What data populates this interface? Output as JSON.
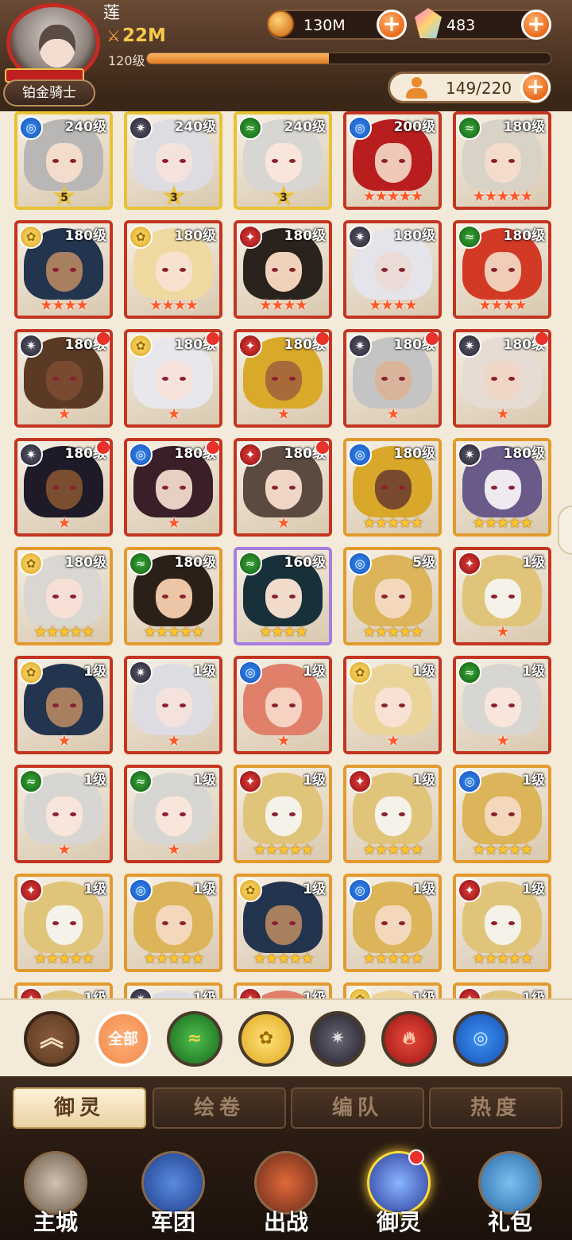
{
  "player": {
    "name": "莲",
    "power": "22M",
    "level": "120级",
    "exp_fraction": 0.45,
    "rank_title": "铂金骑士"
  },
  "resources": {
    "gold": "130M",
    "gems": "483",
    "capacity": "149/220"
  },
  "elements_legend": {
    "water": "#1f6fd6",
    "dark": "#3a3845",
    "wind": "#1f8a2a",
    "fire": "#c9221f",
    "light": "#e8b52a"
  },
  "heroes": [
    {
      "level": "240级",
      "element": "water",
      "stars": 0,
      "badge": "5",
      "frame": "yellow",
      "hair": "#b9b7b5",
      "skin": "#f3dccc"
    },
    {
      "level": "240级",
      "element": "dark",
      "stars": 0,
      "badge": "3",
      "frame": "yellow",
      "hair": "#dcdce2",
      "skin": "#f5e2dc"
    },
    {
      "level": "240级",
      "element": "wind",
      "stars": 0,
      "badge": "3",
      "frame": "yellow",
      "hair": "#d8d6d2",
      "skin": "#f8e6da"
    },
    {
      "level": "200级",
      "element": "water",
      "stars": 5,
      "badge": "",
      "frame": "red",
      "hair": "#b81e1e",
      "skin": "#f0c8b8"
    },
    {
      "level": "180级",
      "element": "wind",
      "stars": 5,
      "badge": "",
      "frame": "red",
      "hair": "#d9d2c6",
      "skin": "#f4dccc"
    },
    {
      "level": "180级",
      "element": "light",
      "stars": 4,
      "badge": "",
      "frame": "red",
      "hair": "#23344f",
      "skin": "#a88060"
    },
    {
      "level": "180级",
      "element": "light",
      "stars": 4,
      "badge": "",
      "frame": "red",
      "hair": "#eed9a0",
      "skin": "#f7e2d0"
    },
    {
      "level": "180级",
      "element": "fire",
      "stars": 4,
      "badge": "",
      "frame": "red",
      "hair": "#2a221c",
      "skin": "#f0d2bb"
    },
    {
      "level": "180级",
      "element": "dark",
      "stars": 4,
      "badge": "",
      "frame": "red",
      "hair": "#e4e4ea",
      "skin": "#ebdcd8"
    },
    {
      "level": "180级",
      "element": "wind",
      "stars": 4,
      "badge": "",
      "frame": "red",
      "hair": "#d23a26",
      "skin": "#f1ccb6"
    },
    {
      "level": "180级",
      "element": "dark",
      "stars": 1,
      "badge": "",
      "frame": "red",
      "hair": "#5a3a24",
      "skin": "#7a4a30",
      "notify": true
    },
    {
      "level": "180级",
      "element": "light",
      "stars": 1,
      "badge": "",
      "frame": "red",
      "hair": "#e8e8ec",
      "skin": "#f6e4dc",
      "notify": true
    },
    {
      "level": "180级",
      "element": "fire",
      "stars": 1,
      "badge": "",
      "frame": "red",
      "hair": "#d9aa2a",
      "skin": "#a86a38",
      "notify": true
    },
    {
      "level": "180级",
      "element": "dark",
      "stars": 1,
      "badge": "",
      "frame": "red",
      "hair": "#c4c4c4",
      "skin": "#d9b49a",
      "notify": true
    },
    {
      "level": "180级",
      "element": "dark",
      "stars": 1,
      "badge": "",
      "frame": "red",
      "hair": "#e6dcd4",
      "skin": "#efd6c6",
      "notify": true
    },
    {
      "level": "180级",
      "element": "dark",
      "stars": 1,
      "badge": "",
      "frame": "red",
      "hair": "#1e1a28",
      "skin": "#7a4e2e",
      "notify": true
    },
    {
      "level": "180级",
      "element": "water",
      "stars": 1,
      "badge": "",
      "frame": "red",
      "hair": "#3a1e28",
      "skin": "#e8cfc4",
      "notify": true
    },
    {
      "level": "180级",
      "element": "fire",
      "stars": 1,
      "badge": "",
      "frame": "red",
      "hair": "#5a4a40",
      "skin": "#f0d6c6",
      "notify": true
    },
    {
      "level": "180级",
      "element": "water",
      "stars": 5,
      "badge": "",
      "frame": "orange",
      "hair": "#d9a82a",
      "skin": "#7a4a2e"
    },
    {
      "level": "180级",
      "element": "dark",
      "stars": 5,
      "badge": "",
      "frame": "orange",
      "hair": "#6a5a8a",
      "skin": "#eeeaf0"
    },
    {
      "level": "180级",
      "element": "light",
      "stars": 5,
      "badge": "",
      "frame": "orange",
      "hair": "#dad6d2",
      "skin": "#f6e0d6"
    },
    {
      "level": "180级",
      "element": "wind",
      "stars": 5,
      "badge": "",
      "frame": "orange",
      "hair": "#2a2018",
      "skin": "#ecc6a6"
    },
    {
      "level": "160级",
      "element": "wind",
      "stars": 4,
      "badge": "",
      "frame": "purple",
      "hair": "#18303a",
      "skin": "#f1dccc"
    },
    {
      "level": "5级",
      "element": "water",
      "stars": 5,
      "badge": "",
      "frame": "orange",
      "hair": "#dcb45a",
      "skin": "#f4d8bc"
    },
    {
      "level": "1级",
      "element": "fire",
      "stars": 1,
      "badge": "",
      "frame": "red",
      "hair": "#e0c47a",
      "skin": "#f5f2ea"
    },
    {
      "level": "1级",
      "element": "light",
      "stars": 1,
      "badge": "",
      "frame": "red",
      "hair": "#23344f",
      "skin": "#a88060"
    },
    {
      "level": "1级",
      "element": "dark",
      "stars": 1,
      "badge": "",
      "frame": "red",
      "hair": "#dcdce2",
      "skin": "#f5e2dc"
    },
    {
      "level": "1级",
      "element": "water",
      "stars": 1,
      "badge": "",
      "frame": "red",
      "hair": "#e0806a",
      "skin": "#f5d2c2"
    },
    {
      "level": "1级",
      "element": "light",
      "stars": 1,
      "badge": "",
      "frame": "red",
      "hair": "#ead49a",
      "skin": "#f7e2d4"
    },
    {
      "level": "1级",
      "element": "wind",
      "stars": 1,
      "badge": "",
      "frame": "red",
      "hair": "#d8d6d2",
      "skin": "#f8e6da"
    },
    {
      "level": "1级",
      "element": "wind",
      "stars": 1,
      "badge": "",
      "frame": "red",
      "hair": "#d8d6d2",
      "skin": "#f8e6da"
    },
    {
      "level": "1级",
      "element": "wind",
      "stars": 1,
      "badge": "",
      "frame": "red",
      "hair": "#d8d6d2",
      "skin": "#f8e6da"
    },
    {
      "level": "1级",
      "element": "fire",
      "stars": 5,
      "badge": "",
      "frame": "orange",
      "hair": "#e0c47a",
      "skin": "#f5f2ea"
    },
    {
      "level": "1级",
      "element": "fire",
      "stars": 5,
      "badge": "",
      "frame": "orange",
      "hair": "#e0c47a",
      "skin": "#f5f2ea"
    },
    {
      "level": "1级",
      "element": "water",
      "stars": 5,
      "badge": "",
      "frame": "orange",
      "hair": "#dcb45a",
      "skin": "#f4d8bc"
    },
    {
      "level": "1级",
      "element": "fire",
      "stars": 5,
      "badge": "",
      "frame": "orange",
      "hair": "#e0c47a",
      "skin": "#f5f2ea"
    },
    {
      "level": "1级",
      "element": "water",
      "stars": 5,
      "badge": "",
      "frame": "orange",
      "hair": "#dcb45a",
      "skin": "#f4d8bc"
    },
    {
      "level": "1级",
      "element": "light",
      "stars": 5,
      "badge": "",
      "frame": "orange",
      "hair": "#23344f",
      "skin": "#a88060"
    },
    {
      "level": "1级",
      "element": "water",
      "stars": 5,
      "badge": "",
      "frame": "orange",
      "hair": "#dcb45a",
      "skin": "#f4d8bc"
    },
    {
      "level": "1级",
      "element": "fire",
      "stars": 5,
      "badge": "",
      "frame": "orange",
      "hair": "#e0c47a",
      "skin": "#f5f2ea"
    },
    {
      "level": "1级",
      "element": "fire",
      "stars": 0,
      "badge": "",
      "frame": "orange",
      "hair": "#e0c47a",
      "skin": "#f5f2ea"
    },
    {
      "level": "1级",
      "element": "dark",
      "stars": 0,
      "badge": "",
      "frame": "orange",
      "hair": "#dcdce2",
      "skin": "#f5e2dc"
    },
    {
      "level": "1级",
      "element": "fire",
      "stars": 0,
      "badge": "",
      "frame": "orange",
      "hair": "#e0806a",
      "skin": "#f5d2c2"
    },
    {
      "level": "1级",
      "element": "light",
      "stars": 0,
      "badge": "",
      "frame": "orange",
      "hair": "#ead49a",
      "skin": "#f7e2d4"
    },
    {
      "level": "1级",
      "element": "fire",
      "stars": 0,
      "badge": "",
      "frame": "orange",
      "hair": "#e0c47a",
      "skin": "#f5f2ea"
    }
  ],
  "filters": {
    "collapse_icon": "double-chevron-up",
    "all_label": "全部",
    "items": [
      "wind",
      "light",
      "dark",
      "fire",
      "water"
    ]
  },
  "subtabs": [
    "御灵",
    "绘卷",
    "编队",
    "热度"
  ],
  "nav": [
    {
      "label": "主城",
      "icon": "castle-icon"
    },
    {
      "label": "军团",
      "icon": "fist-shield-icon"
    },
    {
      "label": "出战",
      "icon": "gate-sword-icon"
    },
    {
      "label": "御灵",
      "icon": "crystal-icon",
      "active": true,
      "notify": true
    },
    {
      "label": "礼包",
      "icon": "shop-icon"
    }
  ]
}
